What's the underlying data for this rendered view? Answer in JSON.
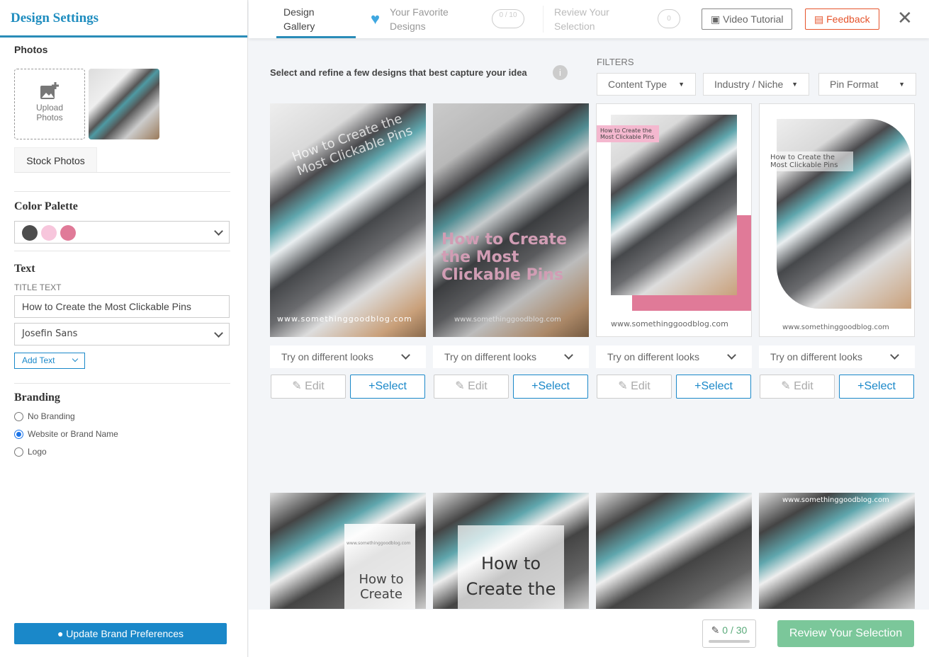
{
  "sidebar": {
    "title": "Design Settings",
    "photos_label": "Photos",
    "upload_label": "Upload Photos",
    "stock_label": "Stock Photos",
    "color_palette_label": "Color Palette",
    "colors": [
      "#4d4d4d",
      "#f7c6dc",
      "#e07a98"
    ],
    "text_label": "Text",
    "title_text_label": "TITLE TEXT",
    "title_text_value": "How to Create the Most Clickable Pins",
    "font": "Josefin Sans",
    "add_text": "Add Text",
    "branding_label": "Branding",
    "branding_options": [
      {
        "label": "No Branding",
        "checked": false
      },
      {
        "label": "Website or Brand Name",
        "checked": true
      },
      {
        "label": "Logo",
        "checked": false
      }
    ],
    "update_button": "Update Brand Preferences"
  },
  "header": {
    "tabs": [
      {
        "label": "Design Gallery",
        "active": true
      },
      {
        "label": "Your Favorite Designs",
        "count": "0 / 10"
      },
      {
        "label": "Review Your Selection",
        "count": "0"
      }
    ],
    "video_tutorial": "Video Tutorial",
    "feedback": "Feedback"
  },
  "main": {
    "instruction": "Select and refine a few designs that best capture your idea",
    "filters_label": "FILTERS",
    "filters": [
      "Content Type",
      "Industry / Niche",
      "Pin Format"
    ],
    "cards": [
      {
        "title": "How to Create the Most Clickable Pins",
        "url": "www.somethinggoodblog.com",
        "looks": "Try on different looks",
        "edit": "Edit",
        "select": "Select"
      },
      {
        "title": "How to Create the Most Clickable Pins",
        "url": "www.somethinggoodblog.com",
        "looks": "Try on different looks",
        "edit": "Edit",
        "select": "Select"
      },
      {
        "title": "How to Create the Most Clickable Pins",
        "url": "www.somethinggoodblog.com",
        "looks": "Try on different looks",
        "edit": "Edit",
        "select": "Select"
      },
      {
        "title": "How to Create the Most Clickable Pins",
        "url": "www.somethinggoodblog.com",
        "looks": "Try on different looks",
        "edit": "Edit",
        "select": "Select"
      }
    ],
    "cards2": [
      {
        "title": "How to Create",
        "url": "www.somethinggoodblog.com"
      },
      {
        "title": "How to Create the"
      },
      {},
      {
        "url": "www.somethinggoodblog.com"
      }
    ]
  },
  "footer": {
    "counter": "0 / 30",
    "review_button": "Review Your Selection"
  }
}
